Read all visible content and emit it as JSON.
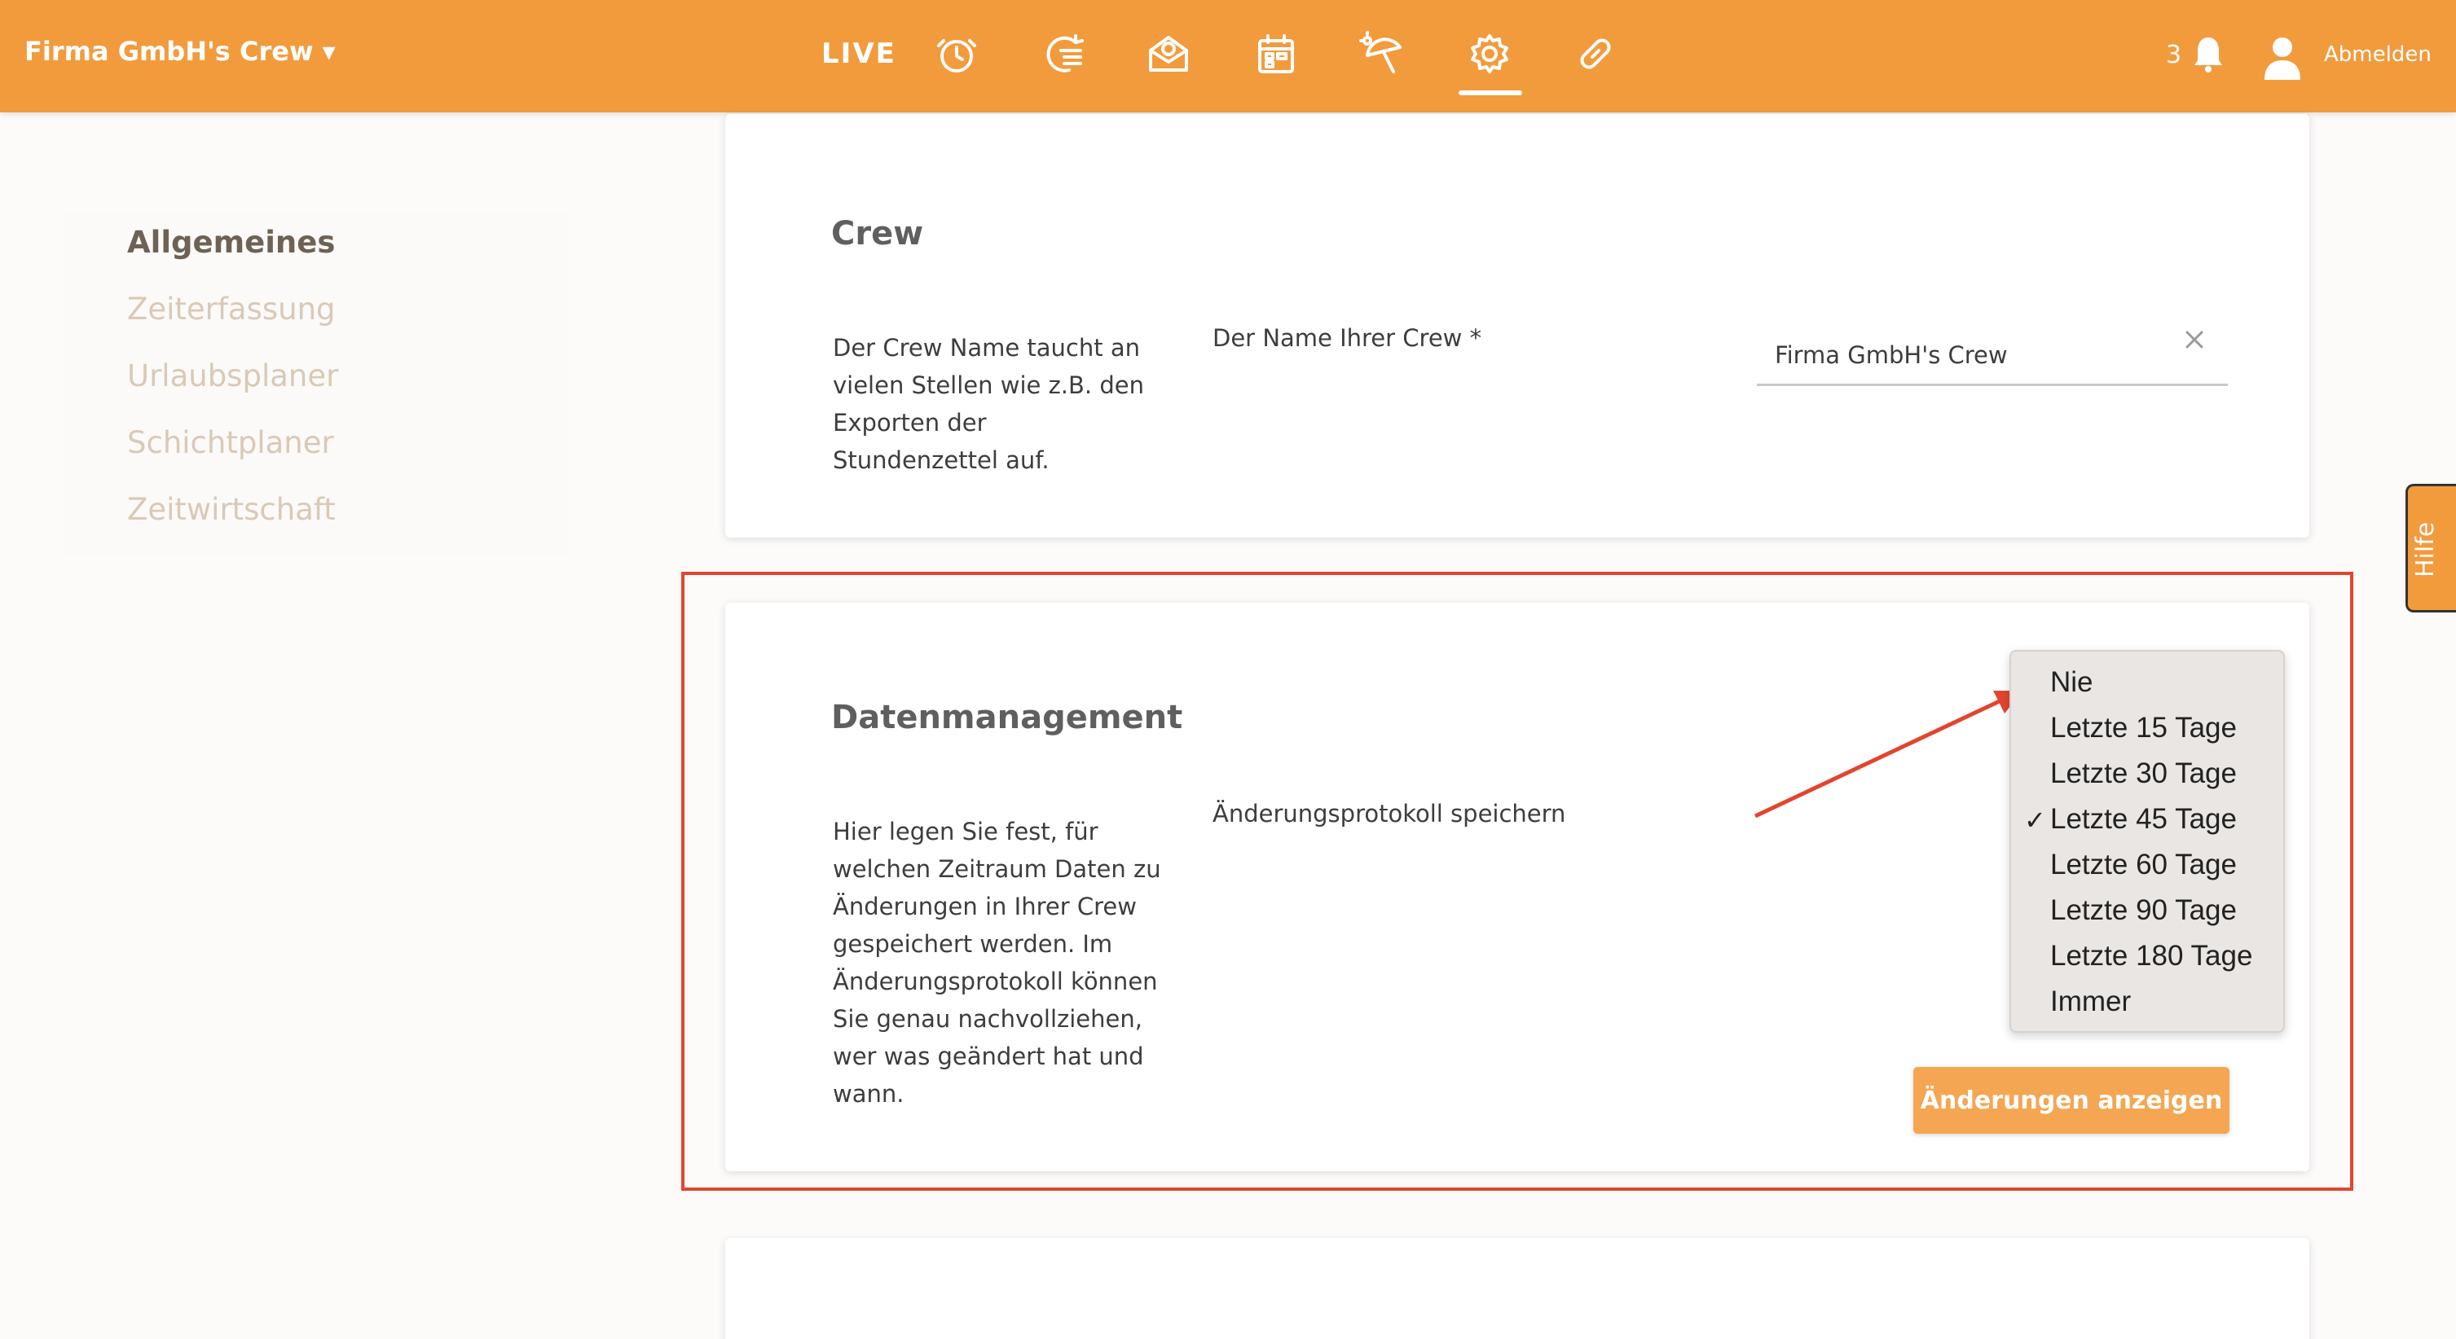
{
  "header": {
    "crew_title": "Firma GmbH's Crew ▾",
    "live_label": "LIVE",
    "nav_icons": [
      "clock-icon",
      "timeline-icon",
      "envelope-euro-icon",
      "calendar-icon",
      "beach-umbrella-icon",
      "gear-icon",
      "link-icon"
    ],
    "active_icon": "gear-icon",
    "notification_count": "3",
    "logout_label": "Abmelden",
    "accent_color": "#f29b3d"
  },
  "sidebar": {
    "items": [
      {
        "label": "Allgemeines",
        "active": true
      },
      {
        "label": "Zeiterfassung"
      },
      {
        "label": "Urlaubsplaner"
      },
      {
        "label": "Schichtplaner"
      },
      {
        "label": "Zeitwirtschaft"
      }
    ]
  },
  "crew_card": {
    "title": "Crew",
    "description": "Der Crew Name taucht an vielen Stellen wie z.B. den Exporten der Stundenzettel auf.",
    "field_label": "Der Name Ihrer Crew *",
    "field_value": "Firma GmbH's Crew"
  },
  "data_card": {
    "title": "Datenmanagement",
    "description": "Hier legen Sie fest, für welchen Zeitraum Daten zu Änderungen in Ihrer Crew gespeichert werden. Im Änderungsprotokoll können Sie genau nachvollziehen, wer was geändert hat und wann.",
    "field_label": "Änderungsprotokoll speichern",
    "dropdown_options": [
      "Nie",
      "Letzte 15 Tage",
      "Letzte 30 Tage",
      "Letzte 45 Tage",
      "Letzte 60 Tage",
      "Letzte 90 Tage",
      "Letzte 180 Tage",
      "Immer"
    ],
    "selected_option": "Letzte 45 Tage",
    "check_mark": "✓",
    "button_label": "Änderungen anzeigen"
  },
  "help_tab": {
    "label": "Hilfe"
  }
}
